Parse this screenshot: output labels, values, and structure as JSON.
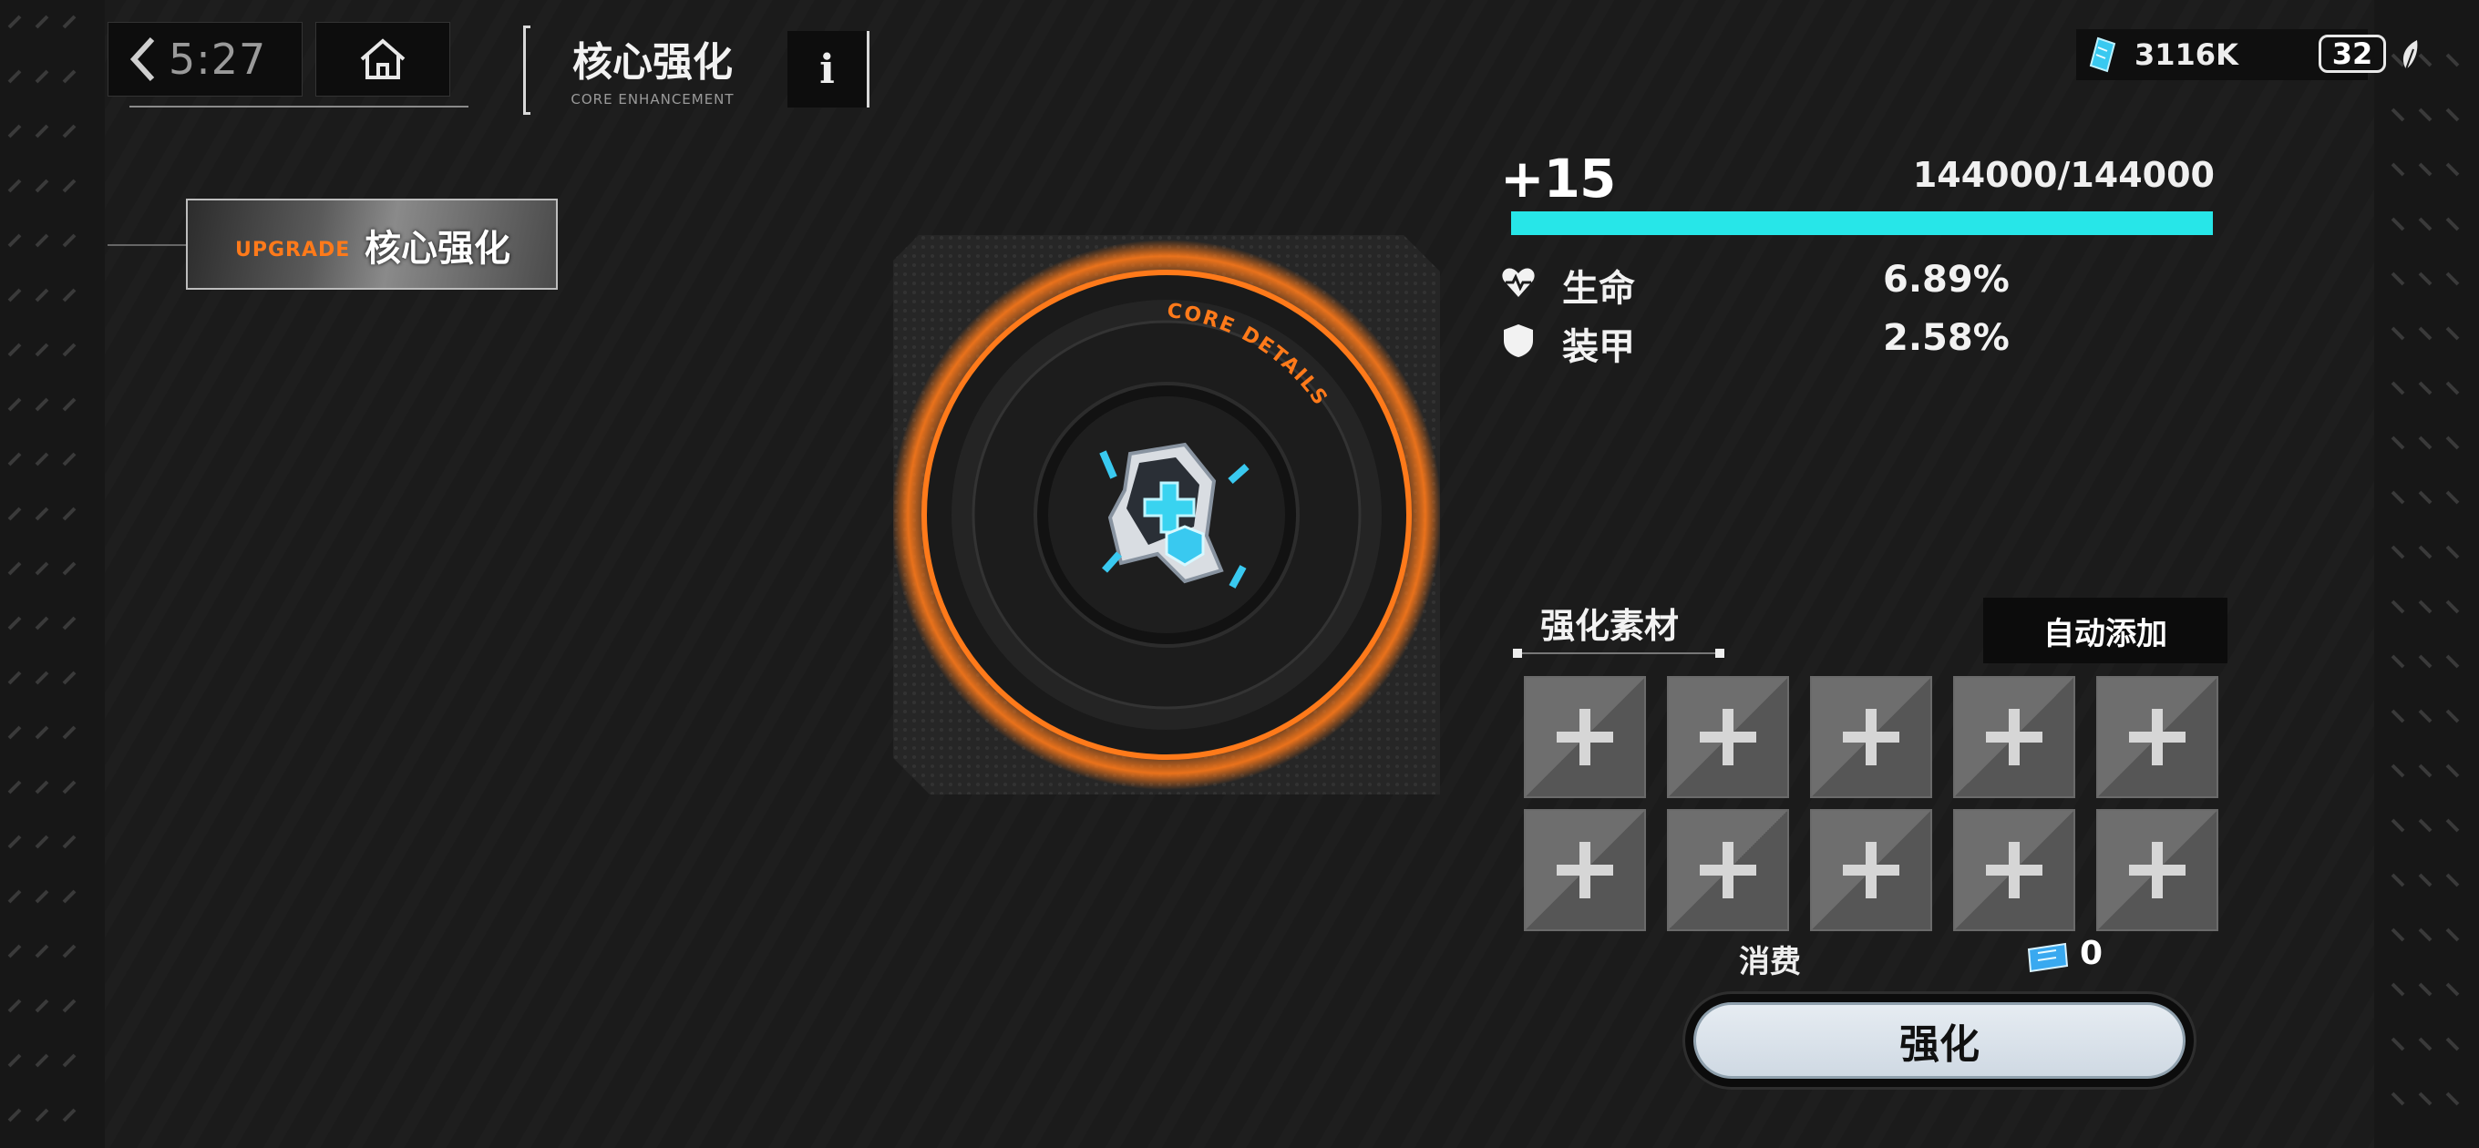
{
  "header": {
    "time": "5:27",
    "title": "核心强化",
    "subtitle": "CORE ENHANCEMENT",
    "info_label": "i"
  },
  "resources": {
    "currency_value": "3116K",
    "level": "32",
    "icons": [
      "gem-ticket-icon",
      "leaf-icon"
    ]
  },
  "tab": {
    "en_label": "UPGRADE",
    "cn_label": "核心强化"
  },
  "core": {
    "ring_label": "CORE DETAILS",
    "accent_color": "#ff7a1a"
  },
  "stats": {
    "level": "+15",
    "exp_text": "144000/144000",
    "exp_fraction": 1.0,
    "bar_color": "#27e6e8",
    "rows": [
      {
        "icon": "heart-icon",
        "label": "生命",
        "value": "6.89%"
      },
      {
        "icon": "shield-icon",
        "label": "装甲",
        "value": "2.58%"
      }
    ]
  },
  "materials": {
    "title": "强化素材",
    "auto_add_label": "自动添加",
    "slot_count": 10,
    "cost_label": "消费",
    "cost_value": "0",
    "strengthen_label": "强化"
  }
}
